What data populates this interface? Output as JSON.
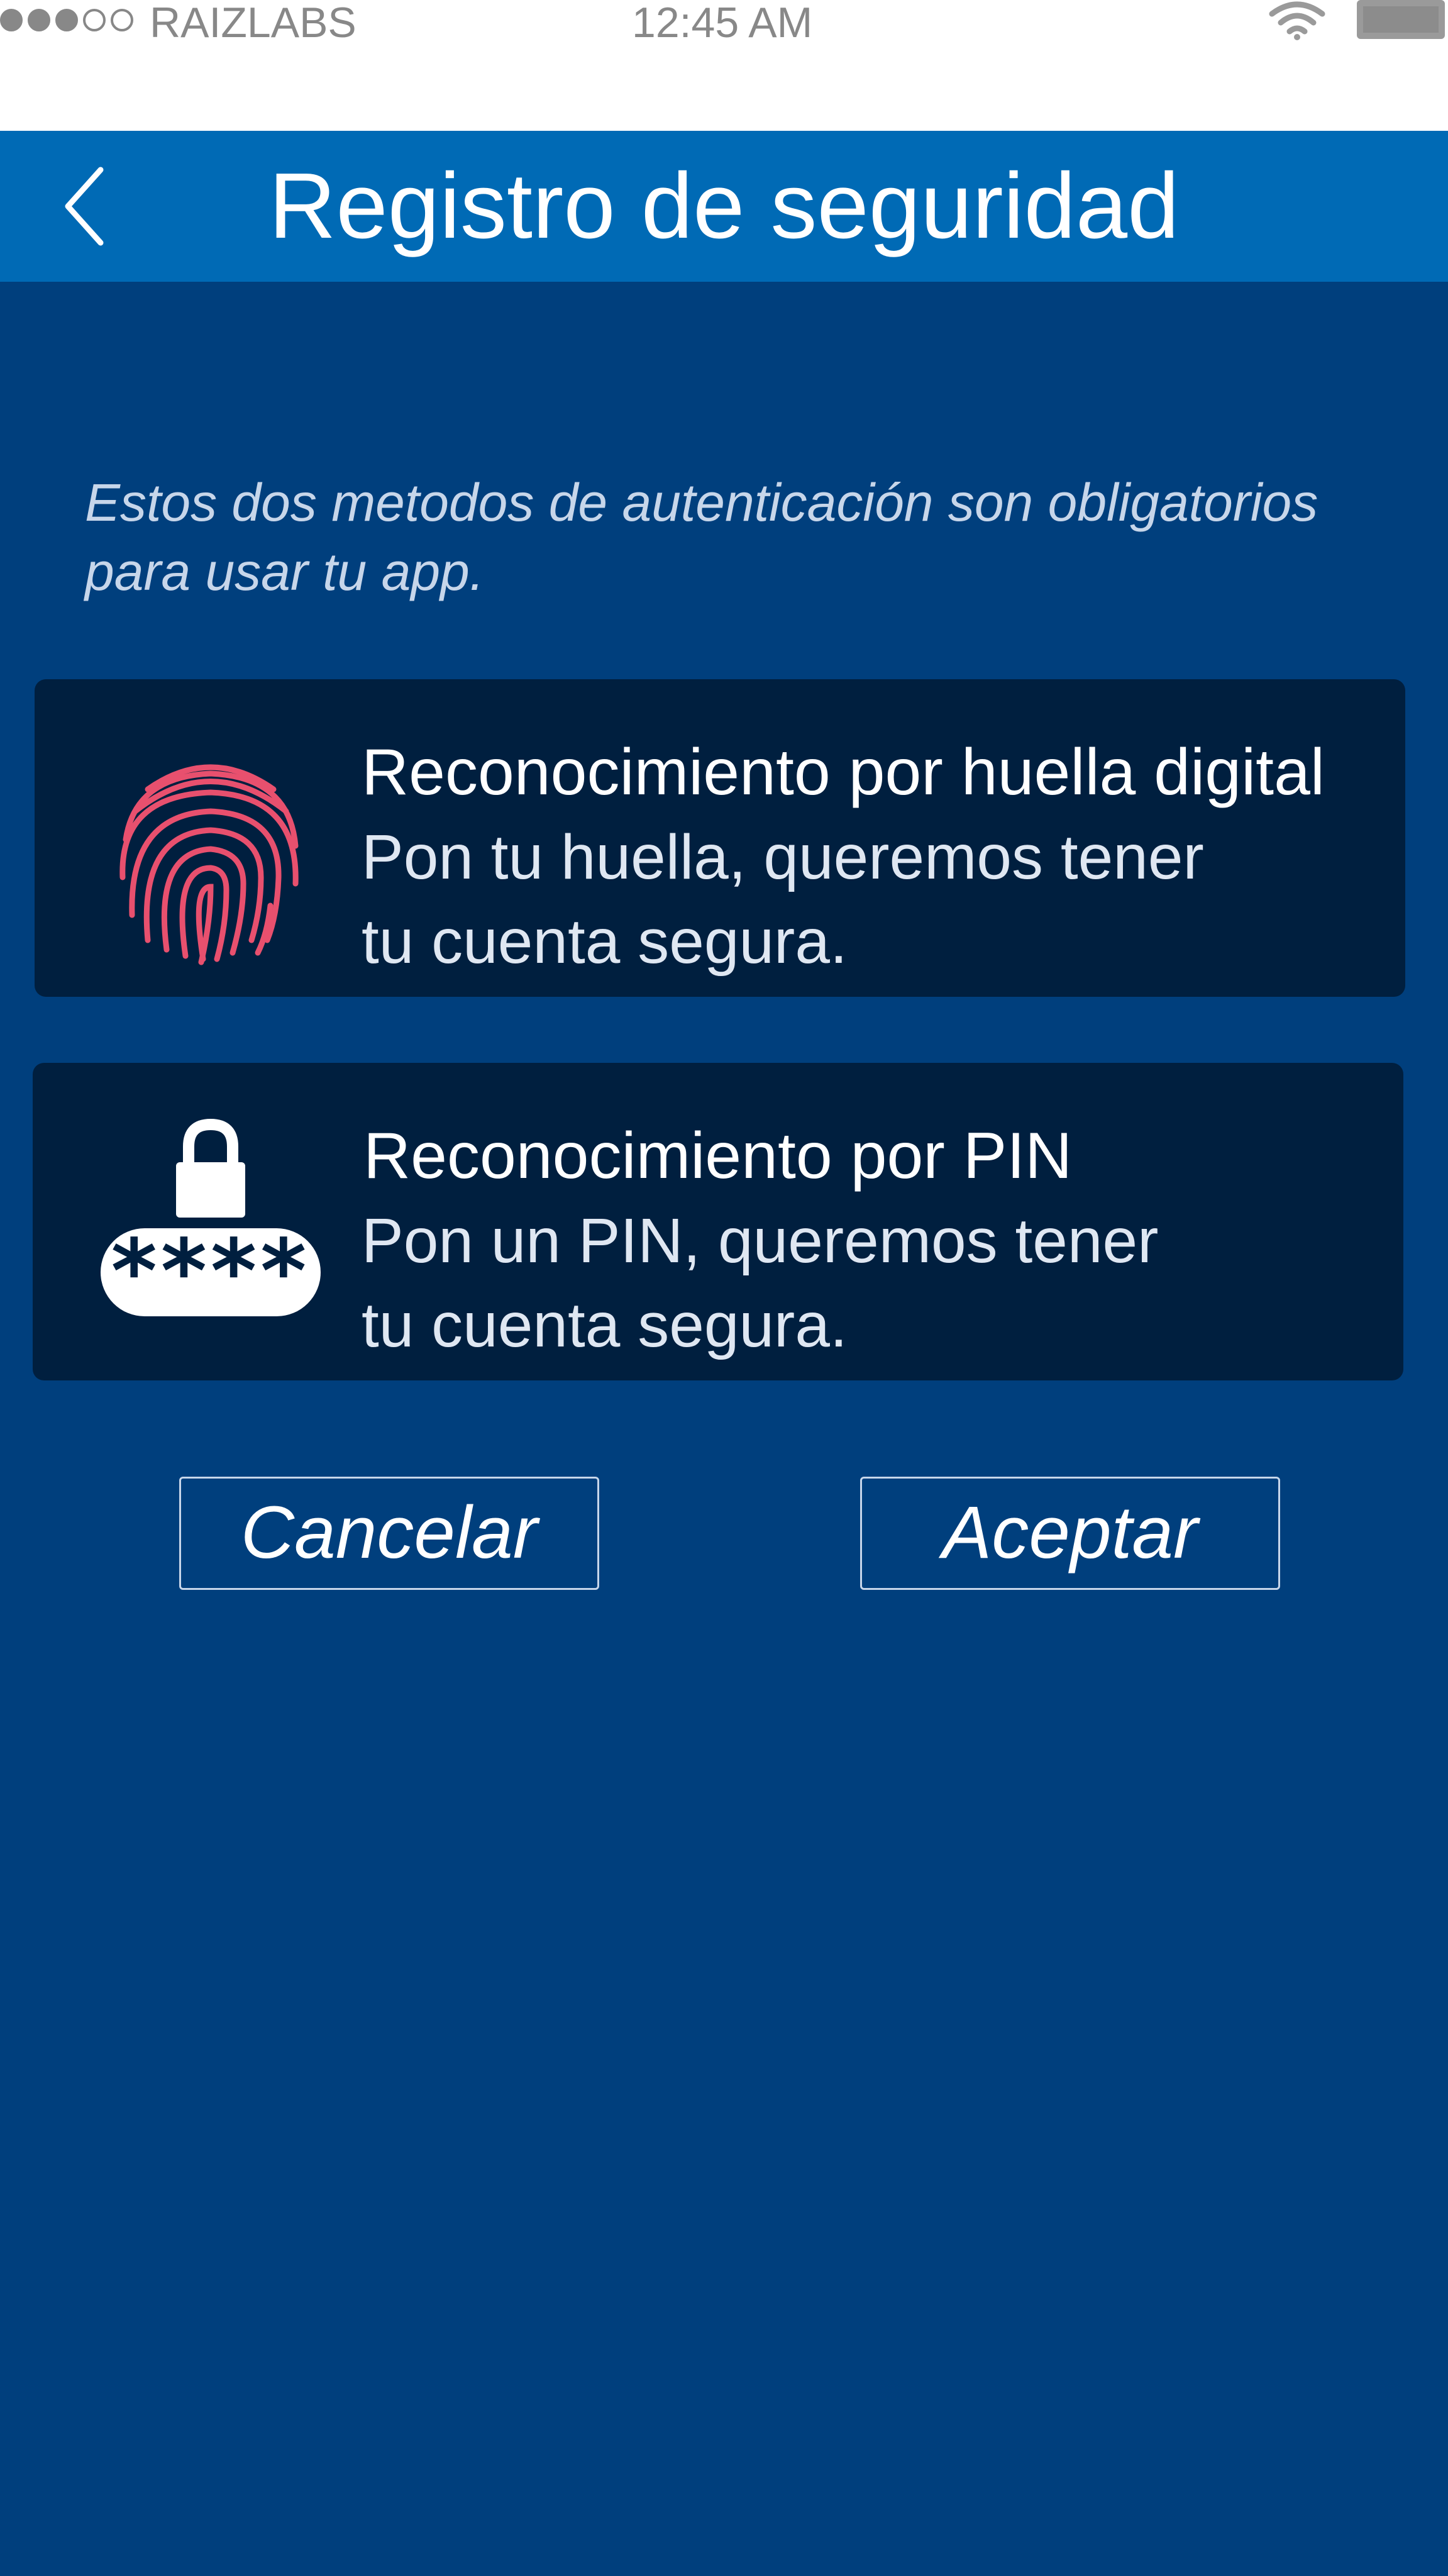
{
  "status_bar": {
    "carrier": "RAIZLABS",
    "time": "12:45 AM",
    "signal_filled": 3,
    "signal_total": 5
  },
  "nav": {
    "title": "Registro de seguridad",
    "back_icon": "chevron-left-icon"
  },
  "intro_text": "Estos dos metodos de autenticación son obligatorios para usar tu app.",
  "options": [
    {
      "title": "Reconocimiento por huella digital",
      "description_line1": "Pon tu  huella, queremos tener",
      "description_line2": "tu cuenta segura.",
      "icon": "fingerprint-icon"
    },
    {
      "title": "Reconocimiento por PIN",
      "description_line1": "Pon un PIN, queremos tener",
      "description_line2": "tu cuenta segura.",
      "icon": "lock-pin-icon",
      "pin_mask": "****"
    }
  ],
  "buttons": {
    "cancel_label": "Cancelar",
    "accept_label": "Aceptar"
  },
  "colors": {
    "nav_bar": "#006ab5",
    "background": "#003f7d",
    "card": "#001f3f",
    "fingerprint": "#e8506e"
  }
}
